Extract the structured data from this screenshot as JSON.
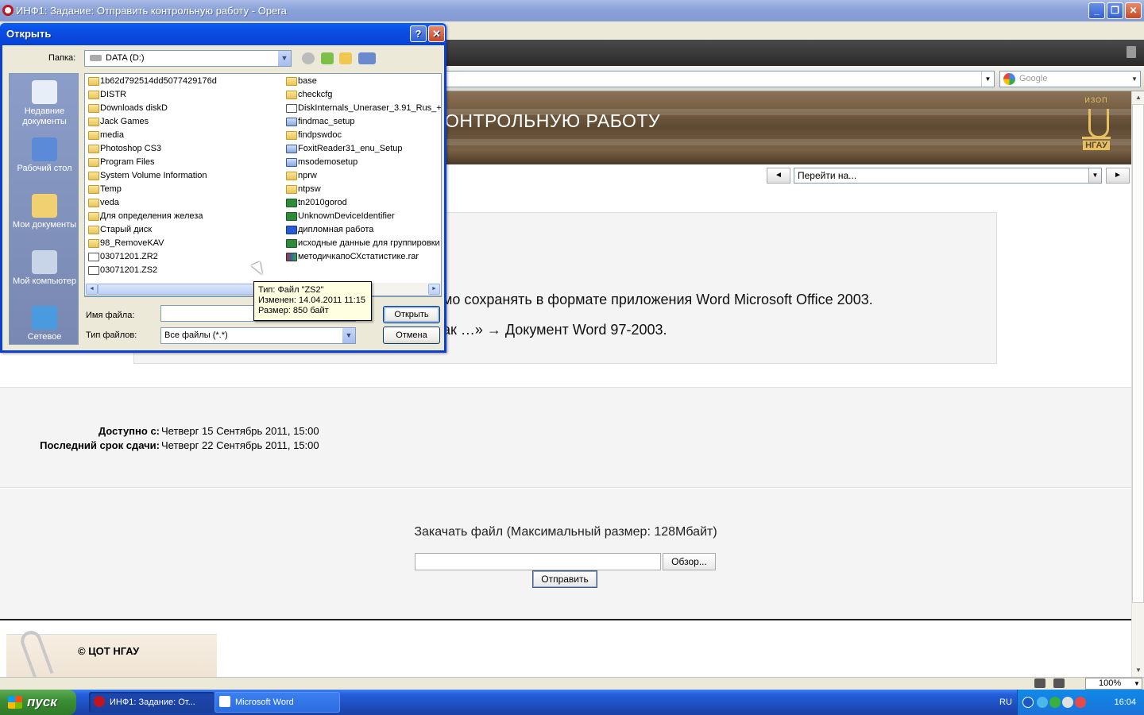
{
  "window": {
    "title": "ИНФ1: Задание: Отправить контрольную работу - Opera",
    "minimize": "_",
    "restore": "❐",
    "close": "✕"
  },
  "browser": {
    "search_placeholder": "Google",
    "zoom": "100%"
  },
  "page": {
    "banner_title": "ОНТРОЛЬНУЮ РАБОТУ",
    "logo_top": "ИЗОП",
    "logo_name": "НГАУ",
    "jump_label": "Перейти на...",
    "prev": "◄",
    "next": "►",
    "desc_line1": "мо сохранять в формате приложения Word  Microsoft  Office 2003.",
    "desc_line2": "ак …» → Документ Word 97-2003.",
    "available_label": "Доступно с:",
    "available_value": "Четверг 15 Сентябрь 2011, 15:00",
    "due_label": "Последний срок сдачи:",
    "due_value": "Четверг 22 Сентябрь 2011, 15:00",
    "upload_title": "Закачать файл (Максимальный размер: 128Мбайт)",
    "browse_label": "Обзор...",
    "submit_label": "Отправить",
    "copyright": "© ЦОТ НГАУ"
  },
  "dialog": {
    "title": "Открыть",
    "help": "?",
    "close": "✕",
    "look_in_label": "Папка:",
    "look_in_value": "DATA (D:)",
    "places": [
      {
        "label": "Недавние документы",
        "color": "#e8eef8"
      },
      {
        "label": "Рабочий стол",
        "color": "#5a8ad8"
      },
      {
        "label": "Мои документы",
        "color": "#f0d070"
      },
      {
        "label": "Мой компьютер",
        "color": "#c8d4e8"
      },
      {
        "label": "Сетевое",
        "color": "#4a9ae0"
      }
    ],
    "files_col1": [
      {
        "name": "1b62d792514dd5077429176d",
        "icon": "folder"
      },
      {
        "name": "DISTR",
        "icon": "folder"
      },
      {
        "name": "Downloads diskD",
        "icon": "folder"
      },
      {
        "name": "Jack Games",
        "icon": "folder"
      },
      {
        "name": "media",
        "icon": "folder"
      },
      {
        "name": "Photoshop CS3",
        "icon": "folder"
      },
      {
        "name": "Program Files",
        "icon": "folder"
      },
      {
        "name": "System Volume Information",
        "icon": "folder"
      },
      {
        "name": "Temp",
        "icon": "folder"
      },
      {
        "name": "veda",
        "icon": "folder"
      },
      {
        "name": "Для определения железа",
        "icon": "folder"
      },
      {
        "name": "Старый диск",
        "icon": "folder"
      },
      {
        "name": "98_RemoveKAV",
        "icon": "folder"
      },
      {
        "name": "03071201.ZR2",
        "icon": "file"
      },
      {
        "name": "03071201.ZS2",
        "icon": "file"
      }
    ],
    "files_col2": [
      {
        "name": "base",
        "icon": "folder"
      },
      {
        "name": "checkcfg",
        "icon": "folder"
      },
      {
        "name": "DiskInternals_Uneraser_3.91_Rus_+_",
        "icon": "file"
      },
      {
        "name": "findmac_setup",
        "icon": "exe"
      },
      {
        "name": "findpswdoc",
        "icon": "folder"
      },
      {
        "name": "FoxitReader31_enu_Setup",
        "icon": "exe"
      },
      {
        "name": "msodemosetup",
        "icon": "exe"
      },
      {
        "name": "nprw",
        "icon": "folder"
      },
      {
        "name": "ntpsw",
        "icon": "folder"
      },
      {
        "name": "tn2010gorod",
        "icon": "xls"
      },
      {
        "name": "UnknownDeviceIdentifier",
        "icon": "xls"
      },
      {
        "name": "дипломная работа",
        "icon": "doc"
      },
      {
        "name": "исходные данные для группировки",
        "icon": "xls"
      },
      {
        "name": "методичкапоСХстатистике.rar",
        "icon": "rar"
      }
    ],
    "filename_label": "Имя файла:",
    "filename_value": "",
    "filetype_label": "Тип файлов:",
    "filetype_value": "Все файлы (*.*)",
    "open_label": "Открыть",
    "cancel_label": "Отмена",
    "tooltip": {
      "line1": "Тип: Файл \"ZS2\"",
      "line2": "Изменен: 14.04.2011 11:15",
      "line3": "Размер: 850 байт"
    }
  },
  "taskbar": {
    "start_label": "пуск",
    "items": [
      {
        "label": "ИНФ1: Задание: От...",
        "active": true
      },
      {
        "label": "Microsoft Word",
        "active": false
      }
    ],
    "lang": "RU",
    "clock": "16:04"
  }
}
